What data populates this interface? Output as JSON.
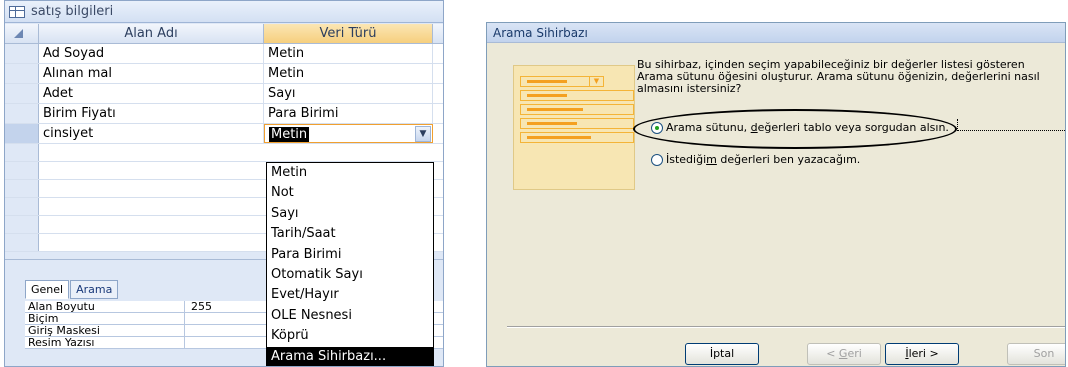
{
  "access": {
    "table_title": "satış bilgileri",
    "columns": {
      "field_name": "Alan Adı",
      "data_type": "Veri Türü"
    },
    "rows": [
      {
        "name": "Ad Soyad",
        "type": "Metin"
      },
      {
        "name": "Alınan mal",
        "type": "Metin"
      },
      {
        "name": "Adet",
        "type": "Sayı"
      },
      {
        "name": "Birim Fiyatı",
        "type": "Para Birimi"
      },
      {
        "name": "cinsiyet",
        "type": "Metin"
      }
    ],
    "dropdown_options": [
      "Metin",
      "Not",
      "Sayı",
      "Tarih/Saat",
      "Para Birimi",
      "Otomatik Sayı",
      "Evet/Hayır",
      "OLE Nesnesi",
      "Köprü",
      "Arama Sihirbazı..."
    ],
    "selected_option_index": 9,
    "tabs": [
      "Genel",
      "Arama"
    ],
    "properties": [
      {
        "label": "Alan Boyutu",
        "value": "255"
      },
      {
        "label": "Biçim",
        "value": ""
      },
      {
        "label": "Giriş Maskesi",
        "value": ""
      },
      {
        "label": "Resim Yazısı",
        "value": ""
      }
    ]
  },
  "wizard": {
    "title": "Arama Sihirbazı",
    "description": "Bu sihirbaz, içinden seçim yapabileceğiniz bir değerler listesi gösteren Arama sütunu öğesini oluşturur.  Arama sütunu öğenizin, değerlerini nasıl almasını istersiniz?",
    "option1": {
      "pre": "Arama sütunu, ",
      "underlined": "d",
      "post": "eğerleri tablo veya sorgudan alsın."
    },
    "option2": {
      "pre": "İstediği",
      "underlined": "m",
      "post": " değerleri ben yazacağım."
    },
    "buttons": {
      "cancel": "İptal",
      "back_pre": "< ",
      "back_u": "G",
      "back_post": "eri",
      "next_u": "İ",
      "next_post": "leri >",
      "finish": "Son"
    },
    "selected_option": 1,
    "accent_color": "#f4a020"
  }
}
